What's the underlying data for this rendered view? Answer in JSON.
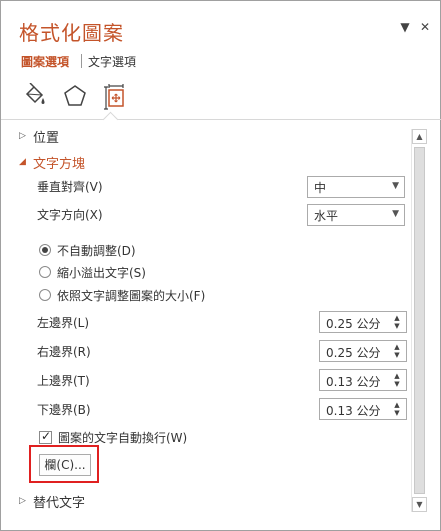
{
  "pane": {
    "title": "格式化圖案",
    "dropdown_glyph": "▼",
    "close_glyph": "✕"
  },
  "tabs": {
    "shape_options": "圖案選項",
    "text_options": "文字選項"
  },
  "icons": {
    "fill_line": "fill-line-icon",
    "effects": "effects-pentagon-icon",
    "size_properties": "size-properties-icon"
  },
  "sections": {
    "position": "位置",
    "textbox": "文字方塊",
    "alt_text": "替代文字",
    "collapsed_glyph": "▷",
    "expanded_glyph": "◢"
  },
  "textbox": {
    "vertical_align_label": "垂直對齊(V)",
    "vertical_align_value": "中",
    "text_direction_label": "文字方向(X)",
    "text_direction_value": "水平",
    "autofit": {
      "selected": 0,
      "options": [
        "不自動調整(D)",
        "縮小溢出文字(S)",
        "依照文字調整圖案的大小(F)"
      ]
    },
    "left_margin_label": "左邊界(L)",
    "left_margin_value": "0.25 公分",
    "right_margin_label": "右邊界(R)",
    "right_margin_value": "0.25 公分",
    "top_margin_label": "上邊界(T)",
    "top_margin_value": "0.13 公分",
    "bottom_margin_label": "下邊界(B)",
    "bottom_margin_value": "0.13 公分",
    "wrap_text_label": "圖案的文字自動換行(W)",
    "wrap_text_checked": true,
    "columns_button": "欄(C)..."
  },
  "colors": {
    "accent": "#c4542a",
    "highlight": "#e02020"
  }
}
